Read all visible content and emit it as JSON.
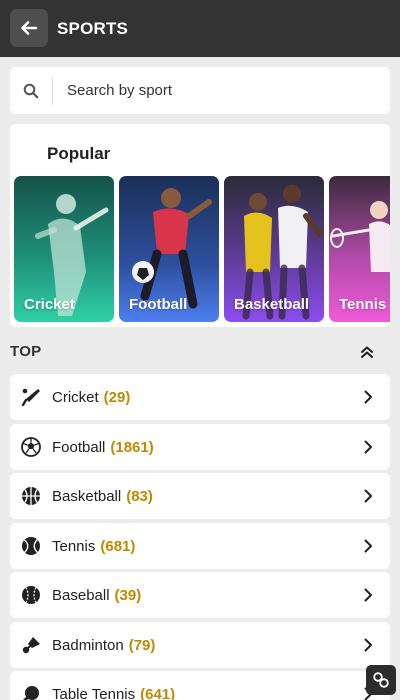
{
  "header": {
    "title": "SPORTS",
    "back_icon": "arrow-left-icon"
  },
  "search": {
    "placeholder": "Search by sport",
    "value": ""
  },
  "popular": {
    "title": "Popular",
    "items": [
      {
        "label": "Cricket"
      },
      {
        "label": "Football"
      },
      {
        "label": "Basketball"
      },
      {
        "label": "Tennis"
      }
    ]
  },
  "top": {
    "title": "TOP",
    "items": [
      {
        "name": "Cricket",
        "count": "(29)",
        "icon": "cricket-bat-icon"
      },
      {
        "name": "Football",
        "count": "(1861)",
        "icon": "soccer-ball-icon"
      },
      {
        "name": "Basketball",
        "count": "(83)",
        "icon": "basketball-icon"
      },
      {
        "name": "Tennis",
        "count": "(681)",
        "icon": "tennis-ball-icon"
      },
      {
        "name": "Baseball",
        "count": "(39)",
        "icon": "baseball-icon"
      },
      {
        "name": "Badminton",
        "count": "(79)",
        "icon": "shuttlecock-icon"
      },
      {
        "name": "Table Tennis",
        "count": "(641)",
        "icon": "table-tennis-icon"
      }
    ]
  },
  "colors": {
    "topbar": "#333333",
    "accent_count": "#c08a00",
    "background": "#ececec"
  }
}
